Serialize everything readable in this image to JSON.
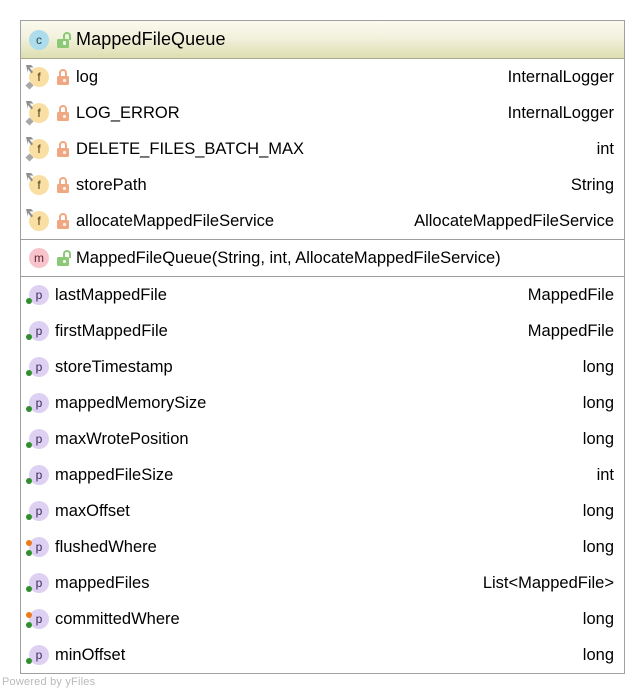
{
  "diagram": {
    "type": "uml-class-diagram",
    "watermark": "Powered by yFiles",
    "colors": {
      "header_gradient_top": "#fbfbef",
      "header_gradient_bottom": "#dedeb0",
      "node_border": "#a0a0a0",
      "row_separator": "#9e9e9e",
      "class_icon_bg": "#addcec",
      "field_icon_bg": "#fadfa4",
      "method_icon_bg": "#f9c3cc",
      "property_icon_bg": "#ddd0f2",
      "lock_private": "#f0a882",
      "lock_public": "#8cc977",
      "accessor_read_dot": "#ef7a18",
      "accessor_write_dot": "#2f8f2f",
      "watermark_text": "#b9b9b9"
    },
    "header": {
      "icon": "class-icon",
      "icon_letter": "c",
      "visibility_icon": "unlocked-padlock-icon",
      "visibility": "public",
      "name": "MappedFileQueue"
    },
    "compartments": [
      {
        "kind": "fields",
        "rows": [
          {
            "icon": "field-icon",
            "icon_letter": "f",
            "static": true,
            "final": true,
            "visibility_icon": "locked-padlock-icon",
            "visibility": "private",
            "name": "log",
            "type": "InternalLogger"
          },
          {
            "icon": "field-icon",
            "icon_letter": "f",
            "static": true,
            "final": true,
            "visibility_icon": "locked-padlock-icon",
            "visibility": "private",
            "name": "LOG_ERROR",
            "type": "InternalLogger"
          },
          {
            "icon": "field-icon",
            "icon_letter": "f",
            "static": true,
            "final": true,
            "visibility_icon": "locked-padlock-icon",
            "visibility": "private",
            "name": "DELETE_FILES_BATCH_MAX",
            "type": "int"
          },
          {
            "icon": "field-icon",
            "icon_letter": "f",
            "static": false,
            "final": true,
            "visibility_icon": "locked-padlock-icon",
            "visibility": "private",
            "name": "storePath",
            "type": "String"
          },
          {
            "icon": "field-icon",
            "icon_letter": "f",
            "static": false,
            "final": true,
            "visibility_icon": "locked-padlock-icon",
            "visibility": "private",
            "name": "allocateMappedFileService",
            "type": "AllocateMappedFileService"
          }
        ]
      },
      {
        "kind": "methods",
        "rows": [
          {
            "icon": "method-icon",
            "icon_letter": "m",
            "static": false,
            "final": false,
            "visibility_icon": "unlocked-padlock-icon",
            "visibility": "public",
            "name": "MappedFileQueue(String, int, AllocateMappedFileService)",
            "type": ""
          }
        ]
      },
      {
        "kind": "properties",
        "rows": [
          {
            "icon": "property-icon",
            "icon_letter": "p",
            "read": false,
            "write": true,
            "name": "lastMappedFile",
            "type": "MappedFile"
          },
          {
            "icon": "property-icon",
            "icon_letter": "p",
            "read": false,
            "write": true,
            "name": "firstMappedFile",
            "type": "MappedFile"
          },
          {
            "icon": "property-icon",
            "icon_letter": "p",
            "read": false,
            "write": true,
            "name": "storeTimestamp",
            "type": "long"
          },
          {
            "icon": "property-icon",
            "icon_letter": "p",
            "read": false,
            "write": true,
            "name": "mappedMemorySize",
            "type": "long"
          },
          {
            "icon": "property-icon",
            "icon_letter": "p",
            "read": false,
            "write": true,
            "name": "maxWrotePosition",
            "type": "long"
          },
          {
            "icon": "property-icon",
            "icon_letter": "p",
            "read": false,
            "write": true,
            "name": "mappedFileSize",
            "type": "int"
          },
          {
            "icon": "property-icon",
            "icon_letter": "p",
            "read": false,
            "write": true,
            "name": "maxOffset",
            "type": "long"
          },
          {
            "icon": "property-icon",
            "icon_letter": "p",
            "read": true,
            "write": true,
            "name": "flushedWhere",
            "type": "long"
          },
          {
            "icon": "property-icon",
            "icon_letter": "p",
            "read": false,
            "write": true,
            "name": "mappedFiles",
            "type": "List<MappedFile>"
          },
          {
            "icon": "property-icon",
            "icon_letter": "p",
            "read": true,
            "write": true,
            "name": "committedWhere",
            "type": "long"
          },
          {
            "icon": "property-icon",
            "icon_letter": "p",
            "read": false,
            "write": true,
            "name": "minOffset",
            "type": "long"
          }
        ]
      }
    ]
  }
}
